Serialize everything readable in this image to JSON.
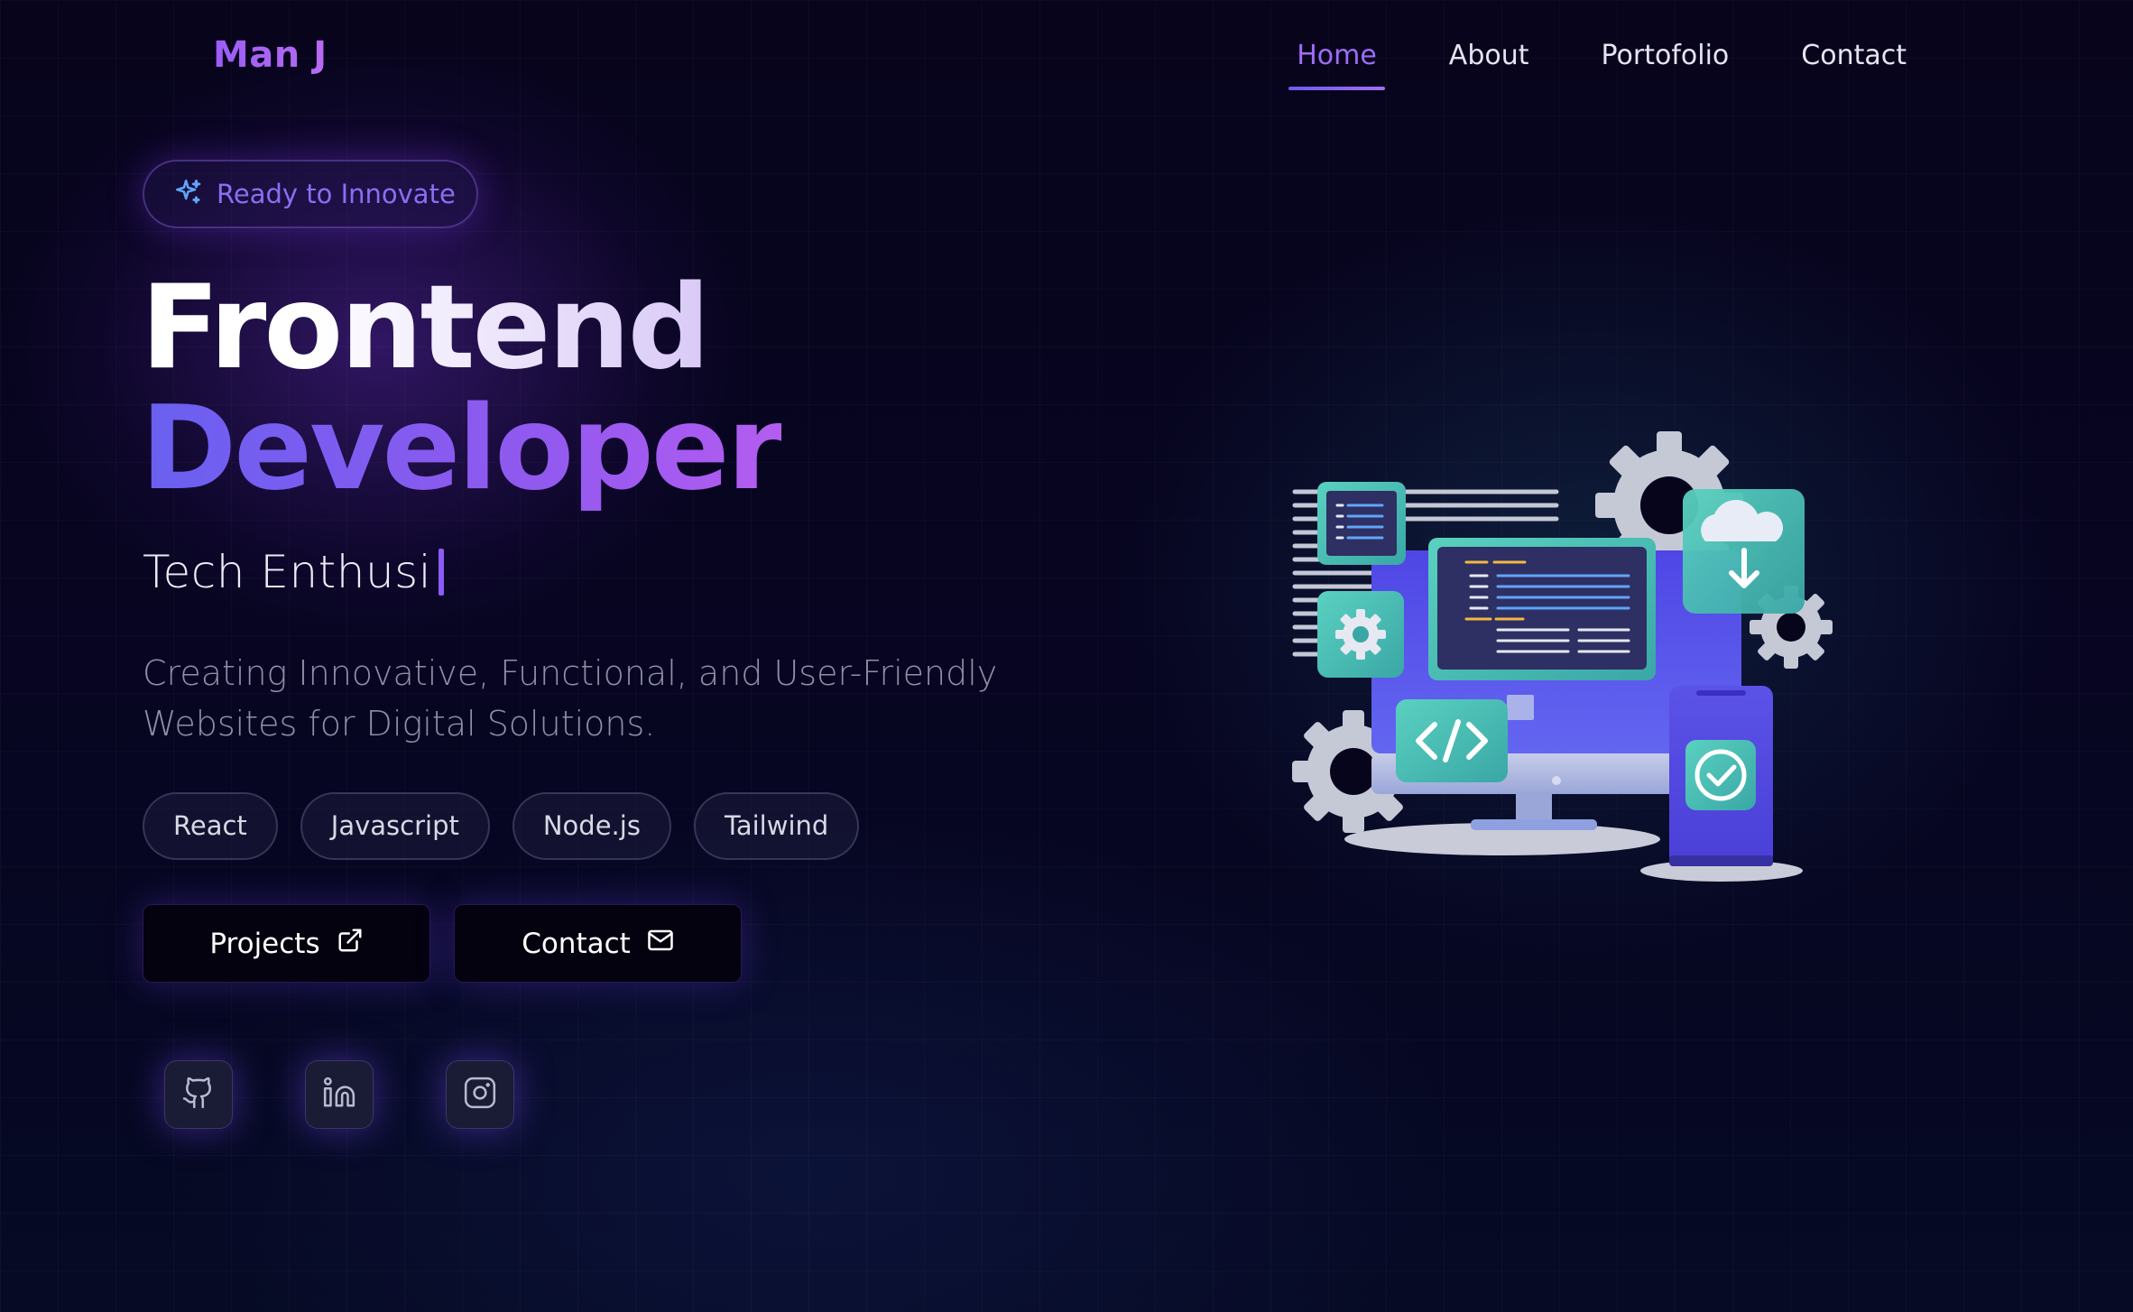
{
  "nav": {
    "logo": "Man J",
    "items": [
      {
        "label": "Home",
        "active": true
      },
      {
        "label": "About",
        "active": false
      },
      {
        "label": "Portofolio",
        "active": false
      },
      {
        "label": "Contact",
        "active": false
      }
    ]
  },
  "hero": {
    "badge": "Ready to Innovate",
    "title_line1": "Frontend",
    "title_line2": "Developer",
    "typing_text": "Tech Enthusi",
    "description": "Creating Innovative, Functional, and User-Friendly Websites for Digital Solutions.",
    "chips": [
      "React",
      "Javascript",
      "Node.js",
      "Tailwind"
    ],
    "buttons": {
      "projects": {
        "label": "Projects",
        "icon": "external-link-icon"
      },
      "contact": {
        "label": "Contact",
        "icon": "mail-icon"
      }
    },
    "socials": [
      {
        "name": "github",
        "icon": "github-icon"
      },
      {
        "name": "linkedin",
        "icon": "linkedin-icon"
      },
      {
        "name": "instagram",
        "icon": "instagram-icon"
      }
    ]
  },
  "illustration": {
    "icon": "developer-workspace-illustration"
  },
  "colors": {
    "accent": "#8b5cf6",
    "accent_blue": "#6366f1",
    "background": "#07041c",
    "teal": "#4fd1b5"
  }
}
